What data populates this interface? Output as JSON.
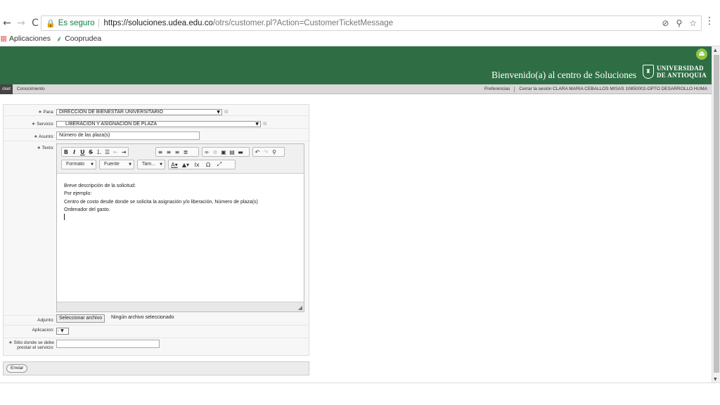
{
  "browser": {
    "back": "←",
    "forward": "→",
    "reload": "C",
    "secure_label": "Es seguro",
    "url_host": "https://soluciones.udea.edu.co",
    "url_path": "/otrs/customer.pl?Action=CustomerTicketMessage",
    "icons": [
      "block-icon",
      "zoom-icon",
      "star-icon"
    ],
    "menu": "⋮"
  },
  "bookmarks": [
    {
      "label": "Aplicaciones",
      "icon": "apps-icon"
    },
    {
      "label": "Cooprudea",
      "icon": "leaf-icon"
    }
  ],
  "header": {
    "welcome": "Bienvenido(a) al centro de Soluciones",
    "uni_line1": "UNIVERSIDAD",
    "uni_line2": "DE ANTIOQUIA"
  },
  "toolbar": {
    "tab_active": "cket",
    "tab_other": "Conocimiento",
    "preferences": "Preferencias",
    "logout": "Cerrar la sesión CLARA MARIA CEBALLOS MISAS 10850002-OPTO DESARROLLO HUMA"
  },
  "form": {
    "para_label": "∗ Para:",
    "para_value": "DIRECCION DE BIENESTAR UNIVERSITARIO",
    "servicio_label": "∗ Servicio:",
    "servicio_value": "LIBERACION Y ASIGNACION DE PLAZA",
    "asunto_label": "∗ Asunto:",
    "asunto_value": "Número de las plaza(s)",
    "texto_label": "∗ Texto:",
    "editor": {
      "formato": "Formato",
      "fuente": "Fuente",
      "tamano": "Tam...",
      "lines": [
        "Breve descripción de la solicitud:",
        "Por ejemplo:",
        "Centro de costo desde donde se solicita la asignación y/o liberación, Número de plaza(s)",
        "Ordenador del gasto."
      ]
    },
    "adjunto_label": "Adjunto:",
    "file_button": "Seleccionar archivo",
    "file_none": "Ningún archivo seleccionado",
    "aplicacion_label": "Aplicacion:",
    "aplicacion_value": "- ▼",
    "sitio_label_1": "∗ Sitio donde se debe",
    "sitio_label_2": "prestar el servicio:",
    "submit": "Enviar"
  }
}
